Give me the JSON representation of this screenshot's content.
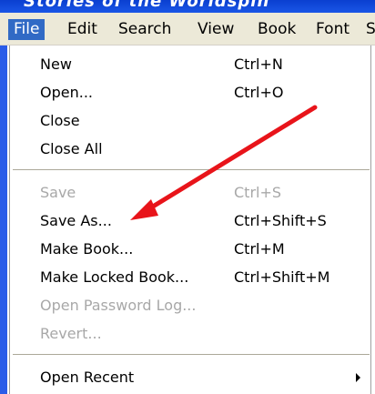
{
  "window": {
    "title": "Stories of the Worldspin"
  },
  "menubar": {
    "items": [
      {
        "label": "File",
        "active": true
      },
      {
        "label": "Edit"
      },
      {
        "label": "Search"
      },
      {
        "label": "View"
      },
      {
        "label": "Book"
      },
      {
        "label": "Font"
      },
      {
        "label": "S"
      }
    ]
  },
  "file_menu": {
    "items": [
      {
        "label": "New",
        "shortcut": "Ctrl+N",
        "enabled": true
      },
      {
        "label": "Open...",
        "shortcut": "Ctrl+O",
        "enabled": true
      },
      {
        "label": "Close",
        "shortcut": "",
        "enabled": true
      },
      {
        "label": "Close All",
        "shortcut": "",
        "enabled": true
      },
      {
        "label": "Save",
        "shortcut": "Ctrl+S",
        "enabled": false
      },
      {
        "label": "Save As...",
        "shortcut": "Ctrl+Shift+S",
        "enabled": true
      },
      {
        "label": "Make Book...",
        "shortcut": "Ctrl+M",
        "enabled": true
      },
      {
        "label": "Make Locked Book...",
        "shortcut": "Ctrl+Shift+M",
        "enabled": true
      },
      {
        "label": "Open Password Log...",
        "shortcut": "",
        "enabled": false
      },
      {
        "label": "Revert...",
        "shortcut": "",
        "enabled": false
      },
      {
        "label": "Open Recent",
        "shortcut": "",
        "enabled": true,
        "submenu": true
      }
    ]
  },
  "annotation": {
    "color": "#e8141a"
  }
}
